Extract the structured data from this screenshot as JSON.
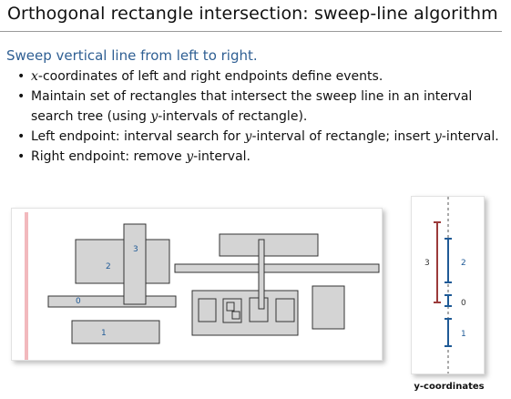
{
  "title": "Orthogonal rectangle intersection:  sweep-line algorithm",
  "heading": "Sweep vertical line from left to right.",
  "bullets": {
    "b1": {
      "var": "x",
      "rest": "-coordinates of left and right endpoints define events."
    },
    "b2": {
      "line1": "Maintain set of rectangles that intersect the sweep line in an interval",
      "pre": "search tree (using ",
      "var": "y",
      "post": "-intervals of rectangle)."
    },
    "b3": {
      "pre": "Left endpoint:  interval search for ",
      "var1": "y",
      "mid": "-interval of rectangle; insert ",
      "var2": "y",
      "post": "-interval."
    },
    "b4": {
      "pre": "Right endpoint:  remove ",
      "var": "y",
      "post": "-interval."
    }
  },
  "diagram": {
    "labels": {
      "r0": "0",
      "r1": "1",
      "r2": "2",
      "r3": "3"
    }
  },
  "intervals": {
    "labels": {
      "i3": "3",
      "i2": "2",
      "i0": "0",
      "i1": "1"
    }
  },
  "caption": "y-coordinates",
  "colors": {
    "heading": "#2f5f93",
    "sweep_line": "#f2b9bd",
    "rect_fill": "#d4d4d4",
    "rect_stroke": "#333333",
    "label_blue": "#1f5a96",
    "interval_red": "#9b3b3b",
    "interval_blue": "#1f5a96"
  }
}
